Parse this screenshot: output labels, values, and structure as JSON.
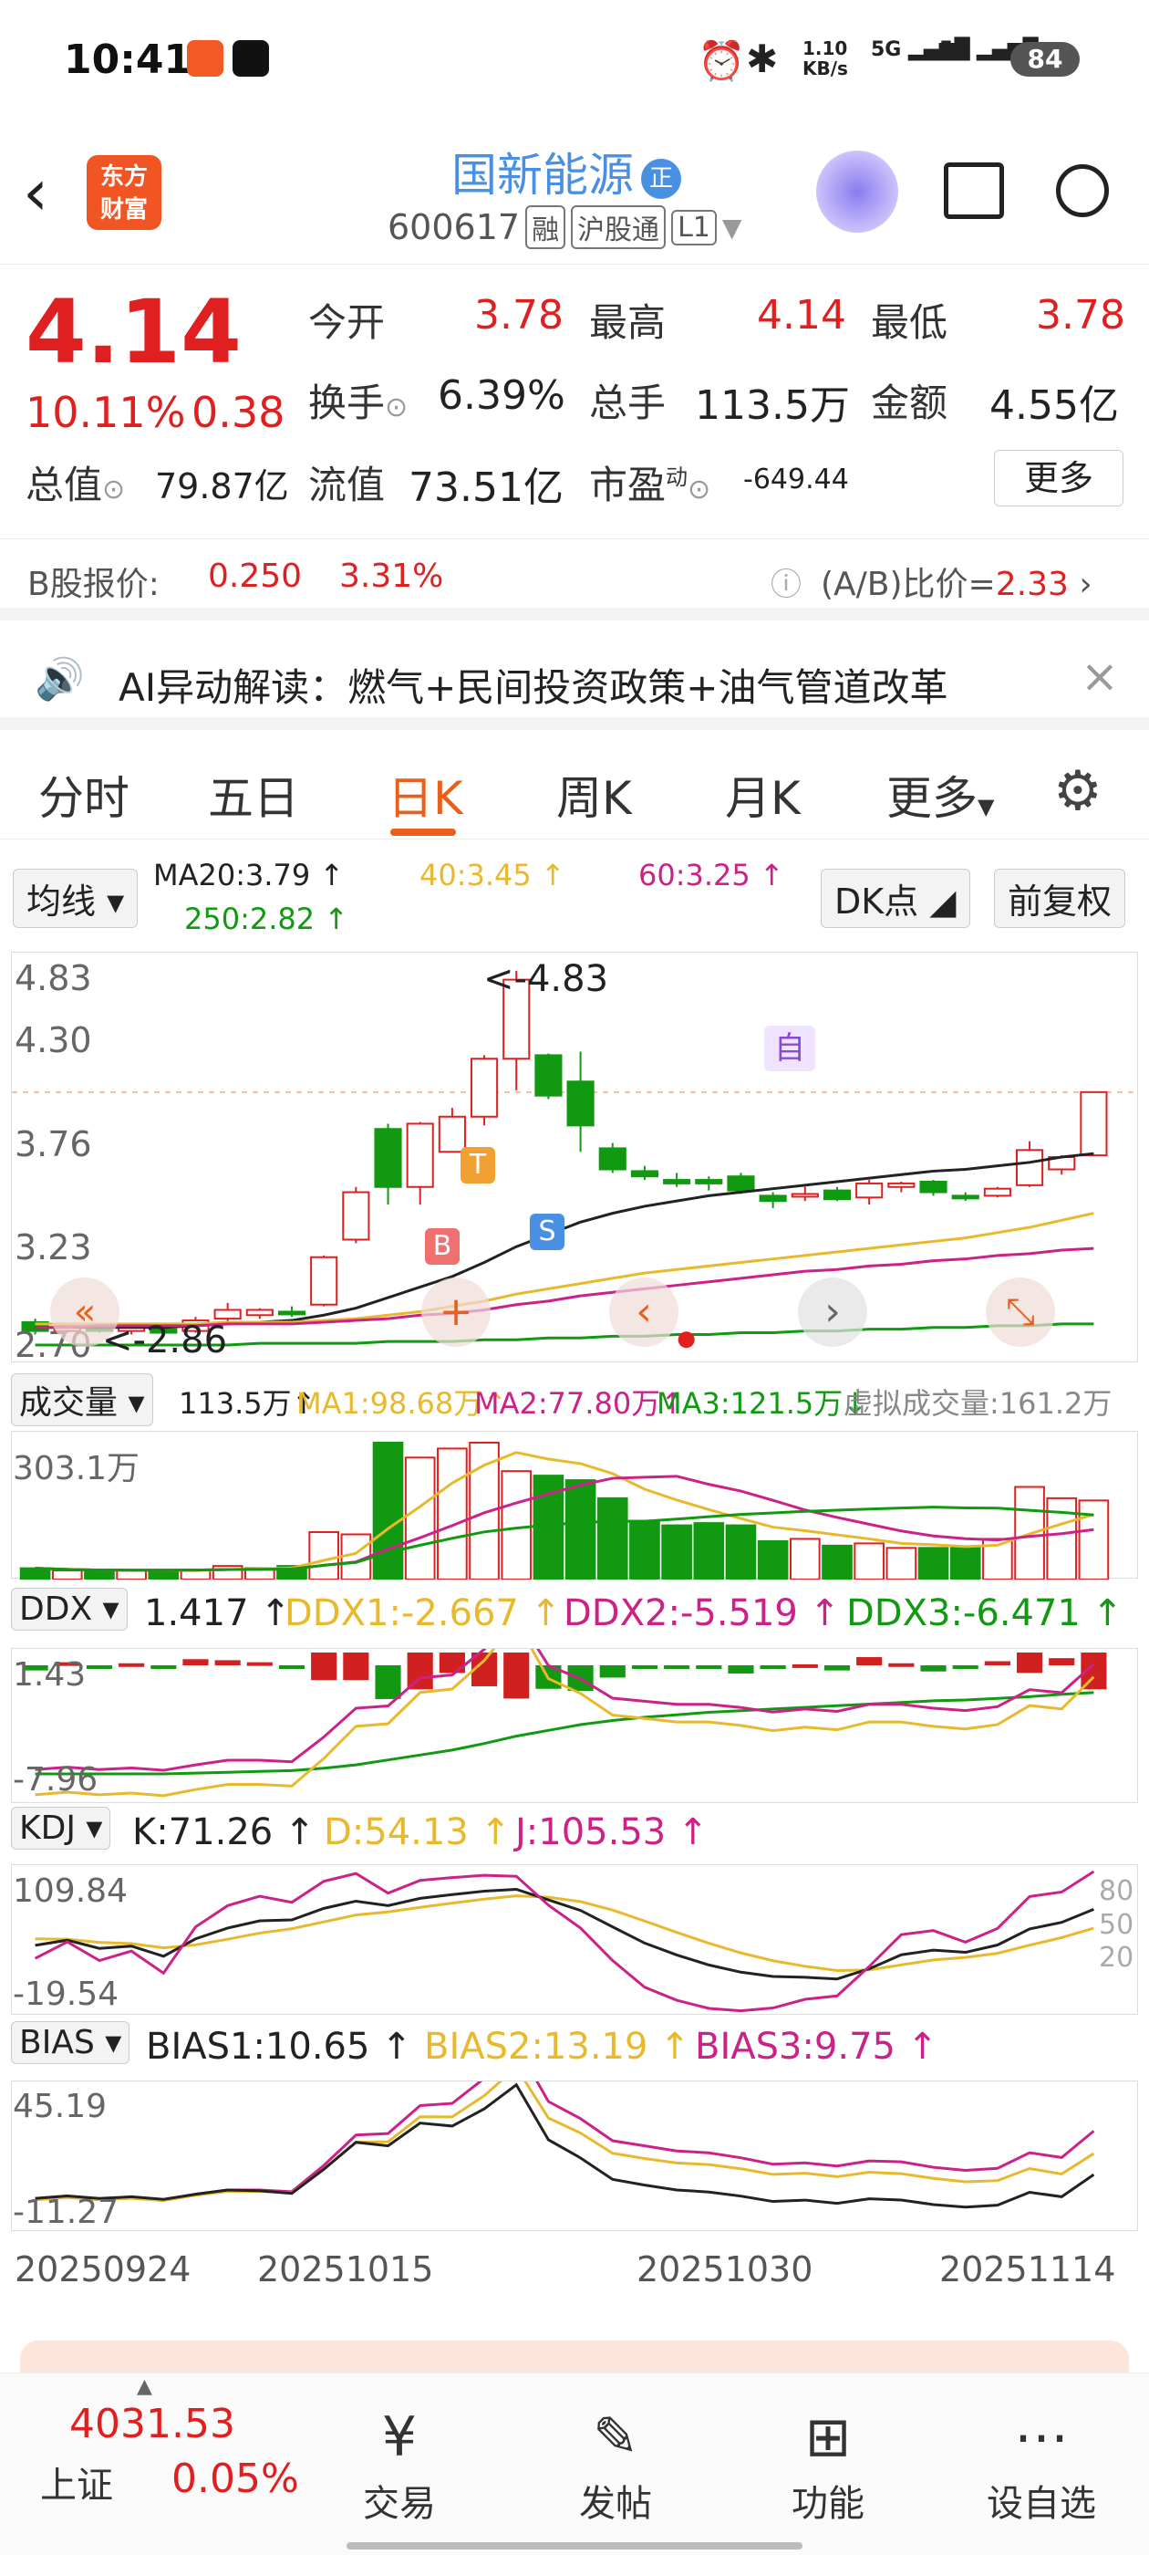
{
  "status_bar": {
    "time": "10:41",
    "net_speed": "1.10\nKB/s",
    "sig1": "5G",
    "sig2": "5G",
    "battery": "84"
  },
  "header": {
    "title": "国新能源",
    "badge": "正",
    "code": "600617",
    "tags": [
      "融",
      "沪股通",
      "L1"
    ],
    "logo": "东方\n财富"
  },
  "quote": {
    "price": "4.14",
    "pct": "10.11%",
    "chg": "0.38",
    "open_l": "今开",
    "open": "3.78",
    "high_l": "最高",
    "high": "4.14",
    "low_l": "最低",
    "low": "3.78",
    "turn_l": "换手",
    "turn": "6.39%",
    "vol_l": "总手",
    "vol": "113.5万",
    "amt_l": "金额",
    "amt": "4.55亿",
    "mcap_l": "总值",
    "mcap": "79.87亿",
    "float_l": "流值",
    "float": "73.51亿",
    "pe_l": "市盈",
    "pe_sup": "动",
    "pe": "-649.44",
    "more": "更多"
  },
  "bshare": {
    "label": "B股报价:",
    "price": "0.250",
    "pct": "3.31%",
    "ratio_l": "(A/B)比价=",
    "ratio": "2.33"
  },
  "ai": {
    "text": "AI异动解读：燃气+民间投资政策+油气管道改革"
  },
  "tabs": [
    "分时",
    "五日",
    "日K",
    "周K",
    "月K",
    "更多"
  ],
  "ma": {
    "btn": "均线",
    "ma20": "MA20:3.79 ↑",
    "ma40": "40:3.45 ↑",
    "ma60": "60:3.25 ↑",
    "ma250": "250:2.82 ↑",
    "dk": "DK点",
    "fq": "前复权"
  },
  "kline": {
    "y_ticks": [
      "4.83",
      "4.30",
      "3.76",
      "3.23",
      "2.70"
    ],
    "hi_label": "<-4.83",
    "lo_label": "<-2.86",
    "mark_zi": "自",
    "mark_t": "T",
    "mark_b": "B",
    "mark_s": "S"
  },
  "vol_ind": {
    "btn": "成交量",
    "v": "113.5万↑",
    "ma1": "MA1:98.68万↑",
    "ma2": "MA2:77.80万↑",
    "ma3": "MA3:121.5万↓",
    "virt": "虚拟成交量:161.2万",
    "top": "303.1万"
  },
  "ddx": {
    "btn": "DDX",
    "v": "1.417 ↑",
    "d1": "DDX1:-2.667 ↑",
    "d2": "DDX2:-5.519 ↑",
    "d3": "DDX3:-6.471 ↑",
    "top": "1.43",
    "bot": "-7.96"
  },
  "kdj": {
    "btn": "KDJ",
    "k": "K:71.26 ↑",
    "d": "D:54.13 ↑",
    "j": "J:105.53 ↑",
    "top": "109.84",
    "bot": "-19.54",
    "r80": "80",
    "r50": "50",
    "r20": "20"
  },
  "bias": {
    "btn": "BIAS",
    "b1": "BIAS1:10.65 ↑",
    "b2": "BIAS2:13.19 ↑",
    "b3": "BIAS3:9.75 ↑",
    "top": "45.19",
    "bot": "-11.27"
  },
  "dates": [
    "20250924",
    "20251015",
    "20251030",
    "20251114"
  ],
  "bottom": {
    "index": "4031.53",
    "name": "上证",
    "pct": "0.05%",
    "items": [
      "交易",
      "发帖",
      "功能",
      "设自选"
    ]
  },
  "chart_data": {
    "type": "candlestick",
    "ylim": [
      2.7,
      4.83
    ],
    "candles": [
      {
        "o": 2.83,
        "c": 2.78,
        "h": 2.85,
        "l": 2.76
      },
      {
        "o": 2.78,
        "c": 2.81,
        "h": 2.82,
        "l": 2.77
      },
      {
        "o": 2.8,
        "c": 2.78,
        "h": 2.81,
        "l": 2.77
      },
      {
        "o": 2.78,
        "c": 2.8,
        "h": 2.81,
        "l": 2.76
      },
      {
        "o": 2.79,
        "c": 2.77,
        "h": 2.8,
        "l": 2.76
      },
      {
        "o": 2.78,
        "c": 2.84,
        "h": 2.86,
        "l": 2.77
      },
      {
        "o": 2.85,
        "c": 2.9,
        "h": 2.94,
        "l": 2.83
      },
      {
        "o": 2.87,
        "c": 2.9,
        "h": 2.91,
        "l": 2.85
      },
      {
        "o": 2.89,
        "c": 2.88,
        "h": 2.92,
        "l": 2.86
      },
      {
        "o": 2.93,
        "c": 3.2,
        "h": 3.21,
        "l": 2.92
      },
      {
        "o": 3.3,
        "c": 3.57,
        "h": 3.6,
        "l": 3.28
      },
      {
        "o": 3.93,
        "c": 3.6,
        "h": 3.96,
        "l": 3.5
      },
      {
        "o": 3.6,
        "c": 3.96,
        "h": 3.97,
        "l": 3.5
      },
      {
        "o": 3.8,
        "c": 4.0,
        "h": 4.05,
        "l": 3.8
      },
      {
        "o": 4.0,
        "c": 4.33,
        "h": 4.35,
        "l": 3.95
      },
      {
        "o": 4.33,
        "c": 4.78,
        "h": 4.83,
        "l": 4.15
      },
      {
        "o": 4.35,
        "c": 4.12,
        "h": 4.36,
        "l": 4.1
      },
      {
        "o": 4.2,
        "c": 3.95,
        "h": 4.37,
        "l": 3.8
      },
      {
        "o": 3.82,
        "c": 3.7,
        "h": 3.85,
        "l": 3.68
      },
      {
        "o": 3.69,
        "c": 3.66,
        "h": 3.72,
        "l": 3.64
      },
      {
        "o": 3.64,
        "c": 3.62,
        "h": 3.68,
        "l": 3.6
      },
      {
        "o": 3.64,
        "c": 3.62,
        "h": 3.66,
        "l": 3.58
      },
      {
        "o": 3.66,
        "c": 3.58,
        "h": 3.68,
        "l": 3.56
      },
      {
        "o": 3.55,
        "c": 3.52,
        "h": 3.57,
        "l": 3.48
      },
      {
        "o": 3.55,
        "c": 3.56,
        "h": 3.6,
        "l": 3.52
      },
      {
        "o": 3.58,
        "c": 3.53,
        "h": 3.6,
        "l": 3.52
      },
      {
        "o": 3.54,
        "c": 3.62,
        "h": 3.64,
        "l": 3.5
      },
      {
        "o": 3.6,
        "c": 3.62,
        "h": 3.63,
        "l": 3.57
      },
      {
        "o": 3.63,
        "c": 3.57,
        "h": 3.64,
        "l": 3.55
      },
      {
        "o": 3.55,
        "c": 3.54,
        "h": 3.57,
        "l": 3.52
      },
      {
        "o": 3.55,
        "c": 3.59,
        "h": 3.6,
        "l": 3.54
      },
      {
        "o": 3.61,
        "c": 3.81,
        "h": 3.86,
        "l": 3.6
      },
      {
        "o": 3.7,
        "c": 3.77,
        "h": 3.78,
        "l": 3.67
      },
      {
        "o": 3.78,
        "c": 4.14,
        "h": 4.14,
        "l": 3.78
      }
    ],
    "ma20": [
      2.8,
      2.8,
      2.8,
      2.8,
      2.8,
      2.81,
      2.82,
      2.83,
      2.84,
      2.87,
      2.91,
      2.97,
      3.03,
      3.09,
      3.17,
      3.26,
      3.33,
      3.4,
      3.45,
      3.49,
      3.52,
      3.55,
      3.57,
      3.59,
      3.61,
      3.63,
      3.65,
      3.67,
      3.69,
      3.7,
      3.72,
      3.74,
      3.77,
      3.79
    ],
    "ma40": [
      2.82,
      2.82,
      2.82,
      2.82,
      2.82,
      2.82,
      2.83,
      2.83,
      2.83,
      2.84,
      2.85,
      2.87,
      2.89,
      2.92,
      2.95,
      2.99,
      3.02,
      3.05,
      3.08,
      3.11,
      3.13,
      3.15,
      3.17,
      3.19,
      3.21,
      3.23,
      3.25,
      3.27,
      3.29,
      3.31,
      3.34,
      3.37,
      3.41,
      3.45
    ],
    "ma60": [
      2.8,
      2.8,
      2.81,
      2.81,
      2.81,
      2.81,
      2.82,
      2.82,
      2.82,
      2.83,
      2.84,
      2.85,
      2.87,
      2.88,
      2.9,
      2.93,
      2.95,
      2.98,
      3.0,
      3.02,
      3.04,
      3.06,
      3.08,
      3.1,
      3.12,
      3.13,
      3.15,
      3.16,
      3.18,
      3.19,
      3.21,
      3.22,
      3.24,
      3.25
    ],
    "ma250": [
      2.7,
      2.7,
      2.7,
      2.7,
      2.7,
      2.7,
      2.7,
      2.71,
      2.71,
      2.71,
      2.71,
      2.72,
      2.72,
      2.72,
      2.73,
      2.73,
      2.74,
      2.74,
      2.75,
      2.75,
      2.76,
      2.76,
      2.77,
      2.77,
      2.78,
      2.78,
      2.79,
      2.79,
      2.8,
      2.8,
      2.81,
      2.81,
      2.82,
      2.82
    ],
    "volume": [
      25,
      20,
      18,
      20,
      20,
      22,
      30,
      25,
      30,
      105,
      100,
      303,
      270,
      290,
      303,
      240,
      230,
      220,
      180,
      130,
      120,
      125,
      120,
      85,
      90,
      75,
      80,
      70,
      70,
      70,
      90,
      205,
      180,
      175
    ]
  }
}
